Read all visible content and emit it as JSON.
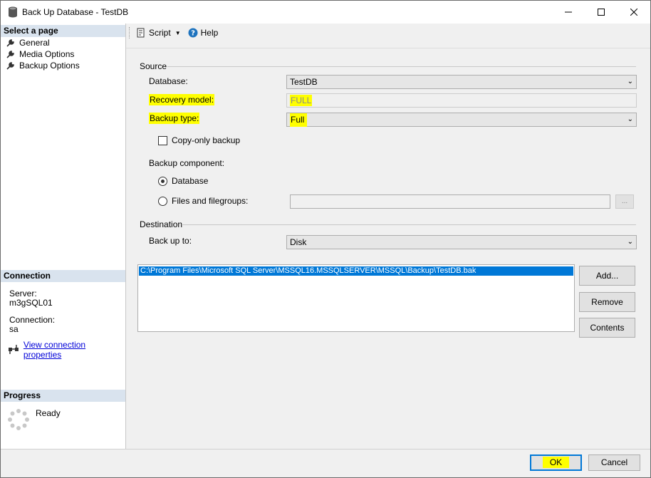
{
  "window": {
    "title": "Back Up Database - TestDB"
  },
  "sidebar": {
    "select_page_header": "Select a page",
    "pages": [
      {
        "label": "General"
      },
      {
        "label": "Media Options"
      },
      {
        "label": "Backup Options"
      }
    ],
    "connection_header": "Connection",
    "server_label": "Server:",
    "server_value": "m3gSQL01",
    "connection_label": "Connection:",
    "connection_value": "sa",
    "view_connection_link": "View connection properties",
    "progress_header": "Progress",
    "progress_status": "Ready"
  },
  "toolbar": {
    "script_label": "Script",
    "help_label": "Help"
  },
  "source": {
    "group_label": "Source",
    "database_label": "Database:",
    "database_value": "TestDB",
    "recovery_model_label": "Recovery model:",
    "recovery_model_value": "FULL",
    "backup_type_label": "Backup type:",
    "backup_type_value": "Full",
    "copy_only_label": "Copy-only backup",
    "copy_only_checked": false,
    "component_label": "Backup component:",
    "component_database_label": "Database",
    "component_files_label": "Files and filegroups:",
    "component_selected": "Database",
    "files_button_label": "..."
  },
  "destination": {
    "group_label": "Destination",
    "backup_to_label": "Back up to:",
    "backup_to_value": "Disk",
    "paths": [
      "C:\\Program Files\\Microsoft SQL Server\\MSSQL16.MSSQLSERVER\\MSSQL\\Backup\\TestDB.bak"
    ],
    "add_label": "Add...",
    "remove_label": "Remove",
    "contents_label": "Contents"
  },
  "footer": {
    "ok_label": "OK",
    "cancel_label": "Cancel"
  },
  "colors": {
    "highlight": "#ffff00",
    "selection": "#0078d7",
    "section_header": "#d9e3ee",
    "link": "#0000d8"
  },
  "icons": [
    "database-icon",
    "minimize-icon",
    "maximize-icon",
    "close-icon",
    "wrench-icon",
    "script-icon",
    "help-icon",
    "connection-icon",
    "spinner-icon"
  ]
}
